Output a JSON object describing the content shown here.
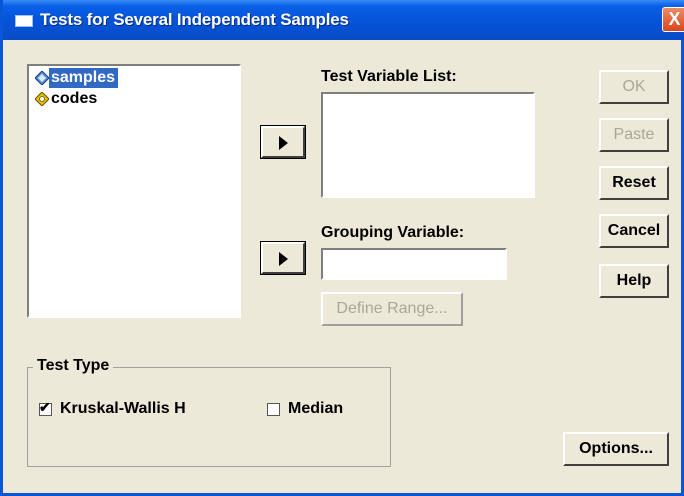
{
  "window": {
    "title": "Tests for Several Independent Samples",
    "close_symbol": "X"
  },
  "variables": [
    {
      "label": "samples",
      "icon": "scale-variable-icon",
      "selected": true
    },
    {
      "label": "codes",
      "icon": "nominal-variable-icon",
      "selected": false
    }
  ],
  "test_variable_list": {
    "label": "Test Variable List:",
    "items": []
  },
  "grouping_variable": {
    "label": "Grouping Variable:",
    "value": ""
  },
  "define_range": {
    "label": "Define Range..."
  },
  "buttons": {
    "ok": "OK",
    "paste": "Paste",
    "reset": "Reset",
    "cancel": "Cancel",
    "help": "Help",
    "options": "Options..."
  },
  "test_type": {
    "title": "Test Type",
    "kruskal_wallis": {
      "label": "Kruskal-Wallis H",
      "checked": true
    },
    "median": {
      "label": "Median",
      "checked": false
    }
  },
  "colors": {
    "titlebar": "#0553d8",
    "dialog_bg": "#ece9d8",
    "selection": "#316ac5",
    "disabled_text": "#a8a89a"
  }
}
